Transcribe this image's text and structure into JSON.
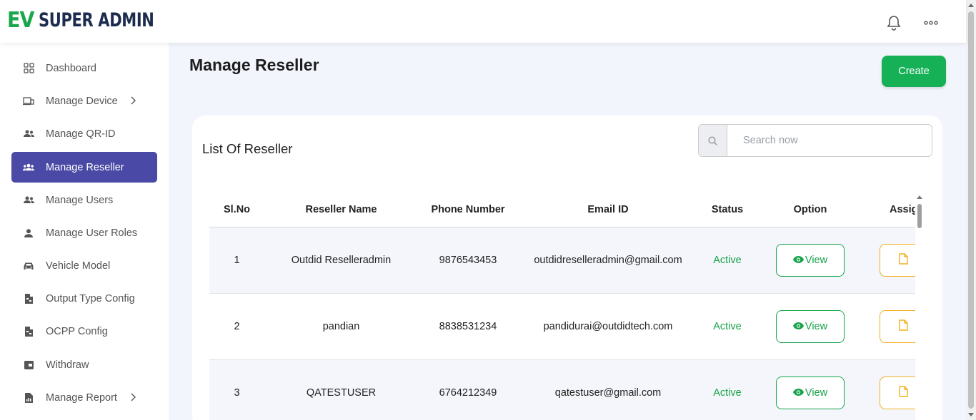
{
  "brand": {
    "ev": "EV",
    "name": "SUPER ADMIN"
  },
  "header": {
    "icons": [
      "bell-icon",
      "more-icon"
    ]
  },
  "sidebar": {
    "items": [
      {
        "label": "Dashboard",
        "icon": "grid-icon",
        "active": false,
        "has_submenu": false
      },
      {
        "label": "Manage Device",
        "icon": "device-icon",
        "active": false,
        "has_submenu": true
      },
      {
        "label": "Manage QR-ID",
        "icon": "users-icon",
        "active": false,
        "has_submenu": false
      },
      {
        "label": "Manage Reseller",
        "icon": "group-icon",
        "active": true,
        "has_submenu": false
      },
      {
        "label": "Manage Users",
        "icon": "users-icon",
        "active": false,
        "has_submenu": false
      },
      {
        "label": "Manage User Roles",
        "icon": "user-icon",
        "active": false,
        "has_submenu": false
      },
      {
        "label": "Vehicle Model",
        "icon": "car-icon",
        "active": false,
        "has_submenu": false
      },
      {
        "label": "Output Type Config",
        "icon": "config-icon",
        "active": false,
        "has_submenu": false
      },
      {
        "label": "OCPP Config",
        "icon": "config-icon",
        "active": false,
        "has_submenu": false
      },
      {
        "label": "Withdraw",
        "icon": "wallet-icon",
        "active": false,
        "has_submenu": false
      },
      {
        "label": "Manage Report",
        "icon": "report-icon",
        "active": false,
        "has_submenu": true
      }
    ]
  },
  "page": {
    "title": "Manage Reseller",
    "create_label": "Create"
  },
  "list": {
    "title": "List Of Reseller",
    "search_placeholder": "Search now",
    "columns": [
      "Sl.No",
      "Reseller Name",
      "Phone Number",
      "Email ID",
      "Status",
      "Option",
      "Assign"
    ],
    "rows": [
      {
        "sl": "1",
        "name": "Outdid Reselleradmin",
        "phone": "9876543453",
        "email": "outdidreselleradmin@gmail.com",
        "status": "Active",
        "option": "View"
      },
      {
        "sl": "2",
        "name": "pandian",
        "phone": "8838531234",
        "email": "pandidurai@outdidtech.com",
        "status": "Active",
        "option": "View"
      },
      {
        "sl": "3",
        "name": "QATESTUSER",
        "phone": "6764212349",
        "email": "qatestuser@gmail.com",
        "status": "Active",
        "option": "View"
      }
    ]
  },
  "colors": {
    "brand_green": "#1aa64a",
    "brand_navy": "#1d2b4f",
    "active_nav": "#4a4aa6",
    "create_button": "#16b157",
    "status_active": "#16a34a",
    "assign_button": "#f2b01e"
  }
}
